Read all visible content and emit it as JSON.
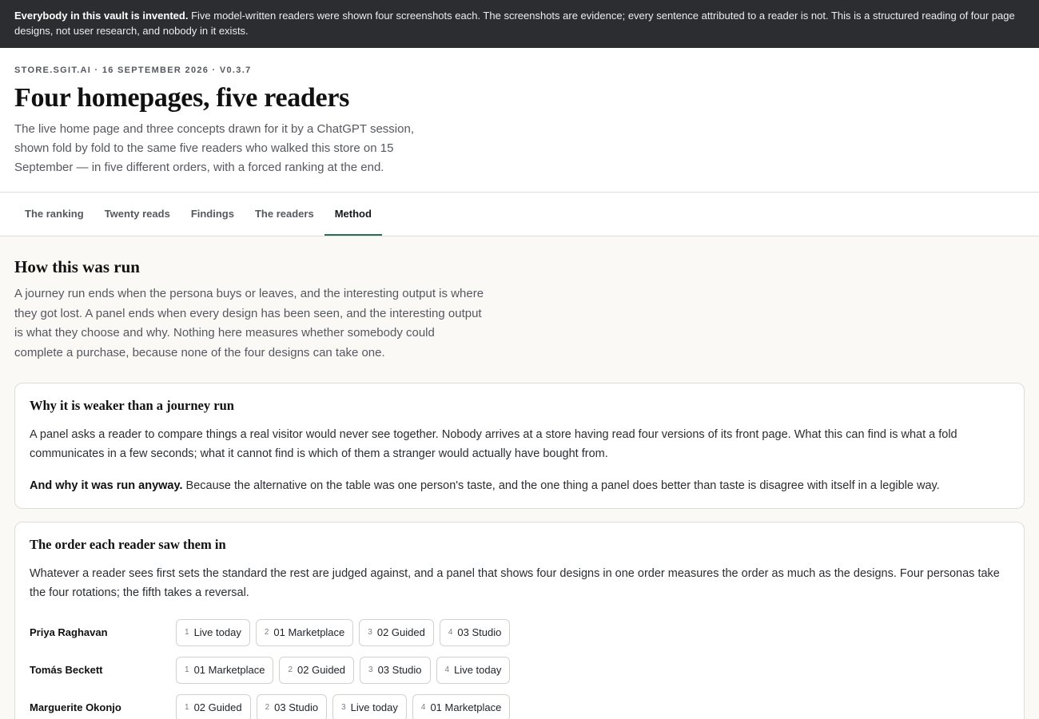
{
  "notice": {
    "bold": "Everybody in this vault is invented.",
    "text": " Five model-written readers were shown four screenshots each. The screenshots are evidence; every sentence attributed to a reader is not. This is a structured reading of four page designs, not user research, and nobody in it exists."
  },
  "header": {
    "meta": "STORE.SGIT.AI · 16 SEPTEMBER 2026 · V0.3.7",
    "title": "Four homepages, five readers",
    "subtitle": "The live home page and three concepts drawn for it by a ChatGPT session, shown fold by fold to the same five readers who walked this store on 15 September — in five different orders, with a forced ranking at the end."
  },
  "tabs": [
    {
      "label": "The ranking"
    },
    {
      "label": "Twenty reads"
    },
    {
      "label": "Findings"
    },
    {
      "label": "The readers"
    },
    {
      "label": "Method"
    }
  ],
  "method": {
    "heading": "How this was run",
    "lead": "A journey run ends when the persona buys or leaves, and the interesting output is where they got lost. A panel ends when every design has been seen, and the interesting output is what they choose and why. Nothing here measures whether somebody could complete a purchase, because none of the four designs can take one.",
    "weaker": {
      "heading": "Why it is weaker than a journey run",
      "p1": "A panel asks a reader to compare things a real visitor would never see together. Nobody arrives at a store having read four versions of its front page. What this can find is what a fold communicates in a few seconds; what it cannot find is which of them a stranger would actually have bought from.",
      "p2_bold": "And why it was run anyway.",
      "p2_text": " Because the alternative on the table was one person's taste, and the one thing a panel does better than taste is disagree with itself in a legible way."
    },
    "order": {
      "heading": "The order each reader saw them in",
      "text": "Whatever a reader sees first sets the standard the rest are judged against, and a panel that shows four designs in one order measures the order as much as the designs. Four personas take the four rotations; the fifth takes a reversal.",
      "rows": [
        {
          "reader": "Priya Raghavan",
          "items": [
            {
              "n": "1",
              "label": "Live today"
            },
            {
              "n": "2",
              "label": "01 Marketplace"
            },
            {
              "n": "3",
              "label": "02 Guided"
            },
            {
              "n": "4",
              "label": "03 Studio"
            }
          ]
        },
        {
          "reader": "Tomás Beckett",
          "items": [
            {
              "n": "1",
              "label": "01 Marketplace"
            },
            {
              "n": "2",
              "label": "02 Guided"
            },
            {
              "n": "3",
              "label": "03 Studio"
            },
            {
              "n": "4",
              "label": "Live today"
            }
          ]
        },
        {
          "reader": "Marguerite Okonjo",
          "items": [
            {
              "n": "1",
              "label": "02 Guided"
            },
            {
              "n": "2",
              "label": "03 Studio"
            },
            {
              "n": "3",
              "label": "Live today"
            },
            {
              "n": "4",
              "label": "01 Marketplace"
            }
          ]
        }
      ]
    }
  },
  "colors": {
    "accent": "#2c6e5c",
    "notice_bg": "#2b2d31"
  }
}
